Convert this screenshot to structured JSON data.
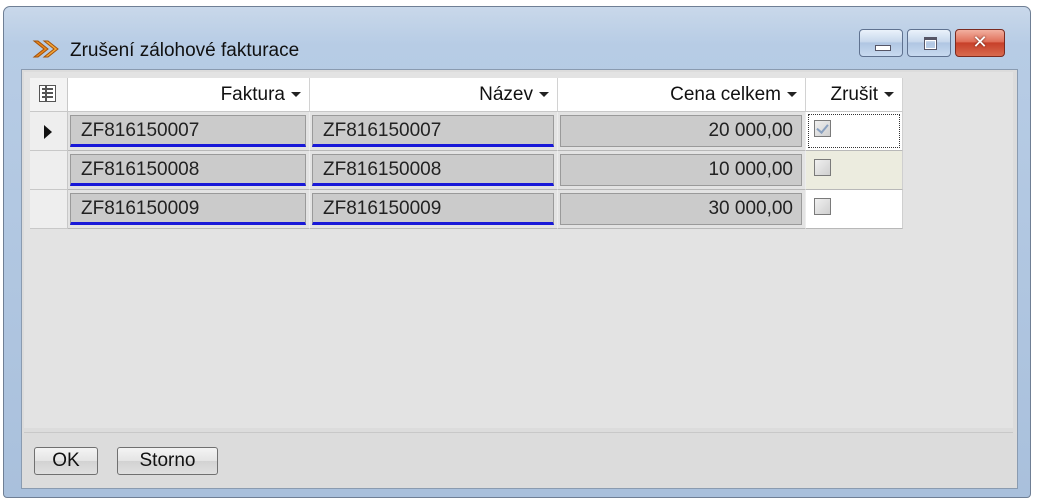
{
  "window": {
    "title": "Zrušení zálohové fakturace",
    "controls": {
      "minimize": "minimize-icon",
      "maximize": "maximize-icon",
      "close": "close-icon"
    }
  },
  "grid": {
    "columns": [
      {
        "label": "Faktura"
      },
      {
        "label": "Název"
      },
      {
        "label": "Cena celkem"
      },
      {
        "label": "Zrušit"
      }
    ],
    "rows": [
      {
        "faktura": "ZF816150007",
        "nazev": "ZF816150007",
        "cena": "20 000,00",
        "zrusit": true,
        "current": true
      },
      {
        "faktura": "ZF816150008",
        "nazev": "ZF816150008",
        "cena": "10 000,00",
        "zrusit": false,
        "current": false
      },
      {
        "faktura": "ZF816150009",
        "nazev": "ZF816150009",
        "cena": "30 000,00",
        "zrusit": false,
        "current": false
      }
    ]
  },
  "buttons": {
    "ok": "OK",
    "cancel": "Storno"
  },
  "colors": {
    "link_underline": "#1818d8",
    "title_gradient_top": "#c9d8ea",
    "close_button": "#c7402a"
  }
}
